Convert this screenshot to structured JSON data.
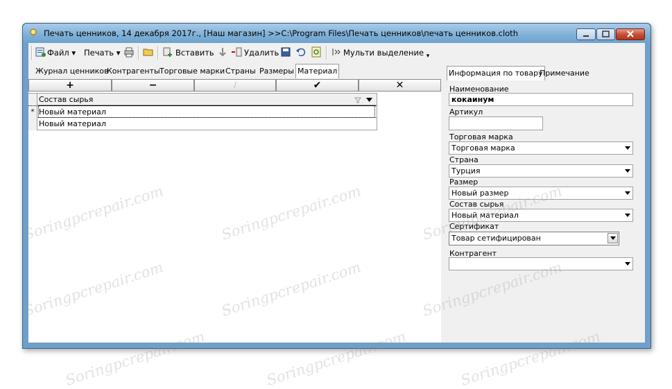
{
  "window": {
    "title": "Печать ценников, 14 декабря 2017г., [Наш магазин] >>C:\\Program Files\\Печать ценников\\печать ценников.cloth"
  },
  "toolbar": {
    "file_label": "Файл",
    "print_label": "Печать",
    "insert_label": "Вставить",
    "delete_label": "Удалить",
    "multi_select_label": "Мульти выделение"
  },
  "tabs": [
    "Журнал ценников",
    "Контрагенты",
    "Торговые марки",
    "Страны",
    "Размеры",
    "Материал"
  ],
  "grid_buttons": [
    "+",
    "−",
    "∕",
    "✔",
    "✕"
  ],
  "grid": {
    "column": "Состав сырья",
    "rows": [
      {
        "marker": "*",
        "value": "Новый материал"
      },
      {
        "marker": "",
        "value": "Новый материал"
      }
    ]
  },
  "right_panel": {
    "tabs": [
      "Информация по товару",
      "Примечание"
    ],
    "name_label": "Наименование",
    "name_value": "кокаинум",
    "article_label": "Артикул",
    "article_value": "",
    "brand_label": "Торговая марка",
    "brand_value": "Торговая марка",
    "country_label": "Страна",
    "country_value": "Турция",
    "size_label": "Размер",
    "size_value": "Новый размер",
    "material_label": "Состав сырья",
    "material_value": "Новый материал",
    "certificate_label": "Сертификат",
    "certificate_value": "Товар сетифицирован",
    "counterparty_label": "Контрагент",
    "counterparty_value": ""
  },
  "watermark": "Soringpcrepair.com"
}
